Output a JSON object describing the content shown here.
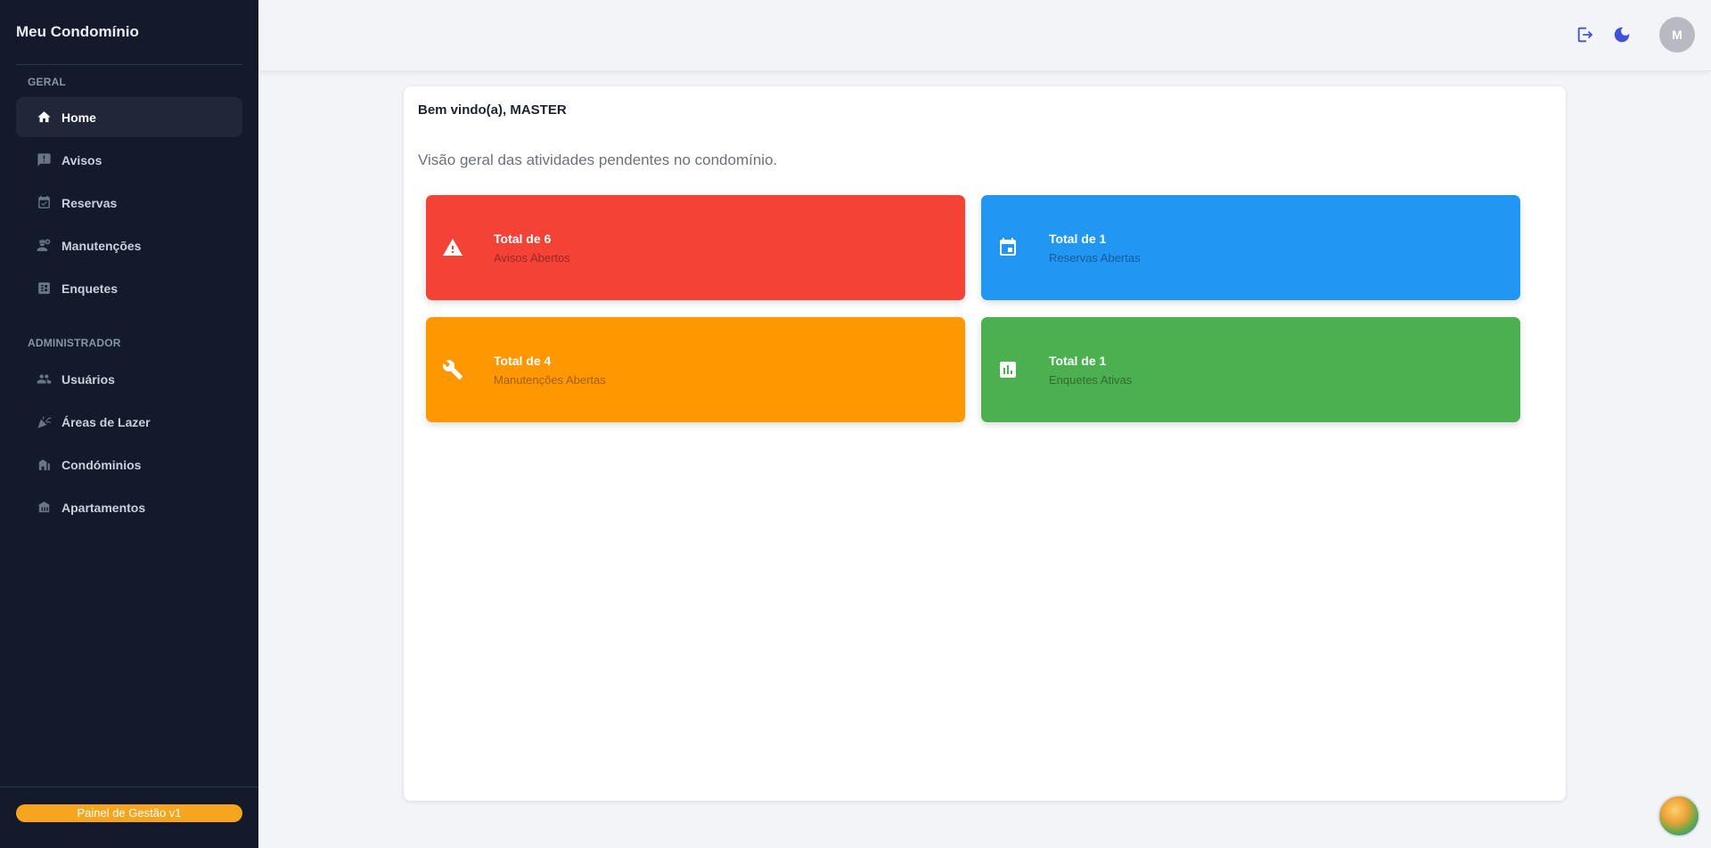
{
  "sidebar": {
    "brand": "Meu Condomínio",
    "sections": [
      {
        "label": "GERAL"
      },
      {
        "label": "ADMINISTRADOR"
      }
    ],
    "items": [
      {
        "label": "Home",
        "icon": "home-icon",
        "active": true
      },
      {
        "label": "Avisos",
        "icon": "announcement-icon"
      },
      {
        "label": "Reservas",
        "icon": "calendar-check-icon"
      },
      {
        "label": "Manutenções",
        "icon": "engineer-icon"
      },
      {
        "label": "Enquetes",
        "icon": "poll-icon"
      },
      {
        "label": "Usuários",
        "icon": "people-icon"
      },
      {
        "label": "Áreas de Lazer",
        "icon": "celebration-icon"
      },
      {
        "label": "Condóminios",
        "icon": "building-icon"
      },
      {
        "label": "Apartamentos",
        "icon": "house-icon"
      }
    ],
    "version": "Painel de Gestão v1"
  },
  "header": {
    "avatar_initial": "M",
    "icons": [
      "logout-icon",
      "dark-mode-icon"
    ],
    "accent_color": "#3f51d6"
  },
  "main": {
    "welcome": "Bem vindo(a), MASTER",
    "subtitle": "Visão geral das atividades pendentes no condomínio.",
    "cards": [
      {
        "title": "Total de 6",
        "subtitle": "Avisos Abertos",
        "color": "#f44336",
        "icon": "warning-icon"
      },
      {
        "title": "Total de 1",
        "subtitle": "Reservas Abertas",
        "color": "#2196f3",
        "icon": "event-icon"
      },
      {
        "title": "Total de 4",
        "subtitle": "Manutenções Abertas",
        "color": "#ff9800",
        "icon": "wrench-icon"
      },
      {
        "title": "Total de 1",
        "subtitle": "Enquetes Ativas",
        "color": "#4caf50",
        "icon": "bar-chart-icon"
      }
    ]
  }
}
